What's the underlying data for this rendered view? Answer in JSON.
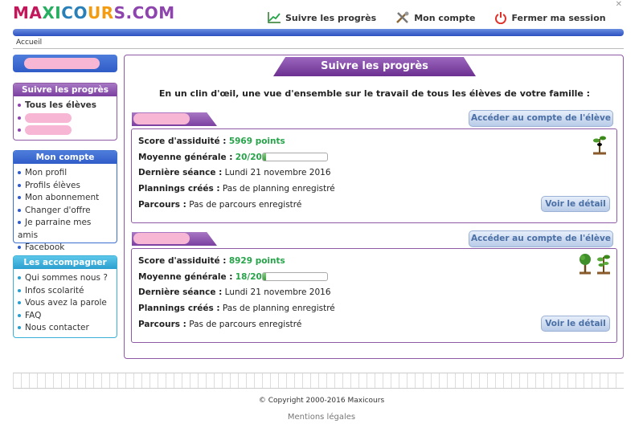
{
  "header": {
    "logo": [
      "MA",
      "XI",
      "CO",
      "UR",
      "S.COM"
    ],
    "nav": [
      {
        "label": "Suivre les progrès",
        "icon": "chart-icon"
      },
      {
        "label": "Mon compte",
        "icon": "tools-icon"
      },
      {
        "label": "Fermer ma session",
        "icon": "power-icon"
      }
    ]
  },
  "breadcrumb": "Accueil",
  "sidebar": {
    "progress": {
      "title": "Suivre les progrès",
      "items": [
        "Tous les élèves"
      ]
    },
    "account": {
      "title": "Mon compte",
      "items": [
        "Mon profil",
        "Profils élèves",
        "Mon abonnement",
        "Changer d'offre",
        "Je parraine mes amis",
        "Facebook"
      ]
    },
    "help": {
      "title": "Les accompagner",
      "items": [
        "Qui sommes nous ?",
        "Infos scolarité",
        "Vous avez la parole",
        "FAQ",
        "Nous contacter"
      ]
    }
  },
  "main": {
    "title": "Suivre les progrès",
    "intro": "En un clin d'œil, une vue d'ensemble sur le travail de tous les élèves de votre famille :",
    "access_label": "Accéder au compte de l'élève",
    "detail_label": "Voir le détail",
    "labels": {
      "score": "Score d'assiduité :",
      "average": "Moyenne générale :",
      "last_session": "Dernière séance :",
      "plannings": "Plannings créés :",
      "courses": "Parcours :"
    },
    "students": [
      {
        "score": "5969 points",
        "average": "20/20",
        "average_fraction": 0.05,
        "last_session": "Lundi 21 novembre 2016",
        "plannings": "Pas de planning enregistré",
        "courses": "Pas de parcours enregistré"
      },
      {
        "score": "8929 points",
        "average": "18/20",
        "average_fraction": 0.05,
        "last_session": "Lundi 21 novembre 2016",
        "plannings": "Pas de planning enregistré",
        "courses": "Pas de parcours enregistré"
      }
    ]
  },
  "footer": {
    "copyright": "© Copyright 2000-2016 Maxicours",
    "mentions": "Mentions légales"
  }
}
